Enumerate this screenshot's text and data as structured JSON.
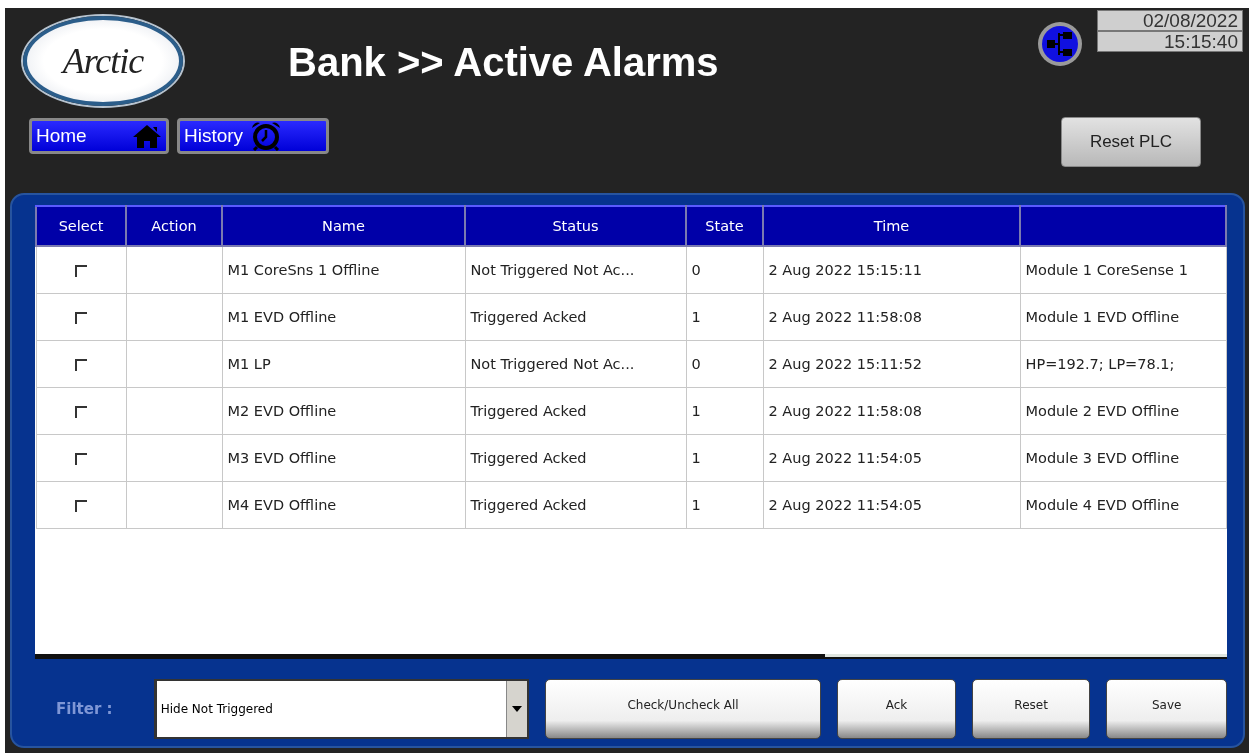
{
  "header": {
    "logo": "Arctic",
    "title": "Bank >> Active Alarms",
    "date": "02/08/2022",
    "time": "15:15:40"
  },
  "nav_buttons": [
    {
      "label": "Home",
      "kind": "home"
    },
    {
      "label": "History",
      "kind": "history"
    }
  ],
  "reset_plc": {
    "label": "Reset PLC"
  },
  "table": {
    "columns": [
      "Select",
      "Action",
      "Name",
      "Status",
      "State",
      "Time",
      ""
    ],
    "rows": [
      {
        "checked": false,
        "name": "M1 CoreSns 1 Offline",
        "status": "Not Triggered Not Ac...",
        "state": "0",
        "time": "2 Aug 2022 15:15:11",
        "column_7": "Module 1 CoreSense 1"
      },
      {
        "checked": false,
        "name": "M1 EVD Offline",
        "status": "Triggered Acked",
        "state": "1",
        "time": "2 Aug 2022 11:58:08",
        "column_7": "Module 1 EVD Offline"
      },
      {
        "checked": false,
        "name": "M1 LP",
        "status": "Not Triggered Not Ac...",
        "state": "0",
        "time": "2 Aug 2022 15:11:52",
        "column_7": "HP=192.7; LP=78.1;"
      },
      {
        "checked": false,
        "name": "M2 EVD Offline",
        "status": "Triggered Acked",
        "state": "1",
        "time": "2 Aug 2022 11:58:08",
        "column_7": "Module 2 EVD Offline"
      },
      {
        "checked": false,
        "name": "M3 EVD Offline",
        "status": "Triggered Acked",
        "state": "1",
        "time": "2 Aug 2022 11:54:05",
        "column_7": "Module 3 EVD Offline"
      },
      {
        "checked": false,
        "name": "M4 EVD Offline",
        "status": "Triggered Acked",
        "state": "1",
        "time": "2 Aug 2022 11:54:05",
        "column_7": "Module 4 EVD Offline"
      }
    ]
  },
  "filter": {
    "label": "Filter :",
    "value": "Hide Not Triggered"
  },
  "buttons": [
    "Check/Uncheck All",
    "Ack",
    "Reset",
    "Save"
  ]
}
